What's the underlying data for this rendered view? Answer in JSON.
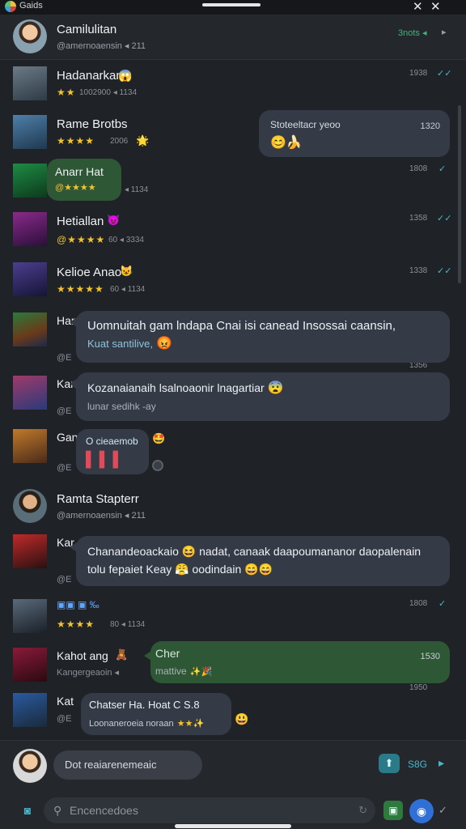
{
  "status_bar": {
    "app_title": "Gaids"
  },
  "header": {
    "name": "Camilulitan",
    "sub": "@amernoaensin ◂ 211",
    "right_text": "3nots ◂",
    "right_icon": "play-arrow-icon"
  },
  "rows": [
    {
      "name": "Hadanarkan",
      "stars": "★★",
      "meta": "1002900 ◂ 1134",
      "time": "1938",
      "read": "✓✓",
      "emoji": "😱"
    },
    {
      "name": "Rame Brotbs",
      "stars": "★★★★",
      "meta": "2006",
      "time": "",
      "read": "",
      "emoji": "🌟"
    },
    {
      "name": "Anarr Hat",
      "stars": "@★★★★",
      "meta": "◂ 1134",
      "time": "1808",
      "read": "✓",
      "emoji": ""
    },
    {
      "name": "Hetiallan",
      "stars": "@★★★★",
      "meta": "60 ◂ 3334",
      "time": "1358",
      "read": "✓✓",
      "emoji": "😈"
    },
    {
      "name": "Kelioe Anao",
      "stars": "★★★★★",
      "meta": "60 ◂ 1134",
      "time": "1338",
      "read": "✓✓",
      "emoji": "😺"
    },
    {
      "name": "Har",
      "stars": "",
      "meta": "@E",
      "time": "1356",
      "read": "",
      "emoji": ""
    },
    {
      "name": "Kan",
      "stars": "",
      "meta": "@E",
      "time": "",
      "read": "",
      "emoji": ""
    },
    {
      "name": "Gan",
      "stars": "",
      "meta": "@E",
      "time": "",
      "read": "",
      "emoji": ""
    },
    {
      "name": "Ramta Stapterr",
      "stars": "",
      "meta": "@amernoaensin ◂ 211",
      "time": "",
      "read": "",
      "emoji": ""
    },
    {
      "name": "Kar",
      "stars": "",
      "meta": "@E",
      "time": "",
      "read": "",
      "emoji": ""
    },
    {
      "name": "▣▣ ▣ ‰",
      "stars": "★★★★",
      "meta": "80 ◂ 1134",
      "time": "1808",
      "read": "✓",
      "emoji": ""
    },
    {
      "name": "Kahot ang",
      "stars": "",
      "meta": "Kangergeaoin ◂",
      "time": "",
      "read": "",
      "emoji": "🧸"
    },
    {
      "name": "Kat",
      "stars": "",
      "meta": "@E",
      "time": "1950",
      "read": "",
      "emoji": ""
    }
  ],
  "bubbles": {
    "b1": {
      "text": "Stoteeltacr yeoo",
      "time": "1320",
      "emoji": "😊🍌"
    },
    "b2": {
      "line1": "Uomnuitah gam lndapa Cnai isi canead Insossai caansin,",
      "line2": "Kuat santilive,",
      "emoji": "😡"
    },
    "b3": {
      "line1": "Kozanaianaih lsalnoaonir lnagartiar",
      "line2": "lunar sedihk -ay",
      "emoji": "😨"
    },
    "b4": {
      "text": "O cieaemob",
      "glyphs": "▌▌▌",
      "emoji": "🤩"
    },
    "b5": {
      "line1": "Chanandeoackaio 😆 nadat, canaak daapoumananor daopalenain",
      "line2": "tolu fepaiet Keay 😤 oodindain 😄😄"
    },
    "b6": {
      "text": "Cher",
      "sub": "mattive",
      "sub_emoji": "✨🎉",
      "time": "1530"
    },
    "b7": {
      "line1": "Chatser Ha. Hoat C S.8",
      "line2": "Loonaneroeia noraan",
      "stars": "★★✨",
      "emoji": "😃"
    }
  },
  "composer": {
    "draft": "Dot reaiarenemeaic",
    "send_count": "S8G",
    "search_placeholder": "Encencedoes"
  }
}
